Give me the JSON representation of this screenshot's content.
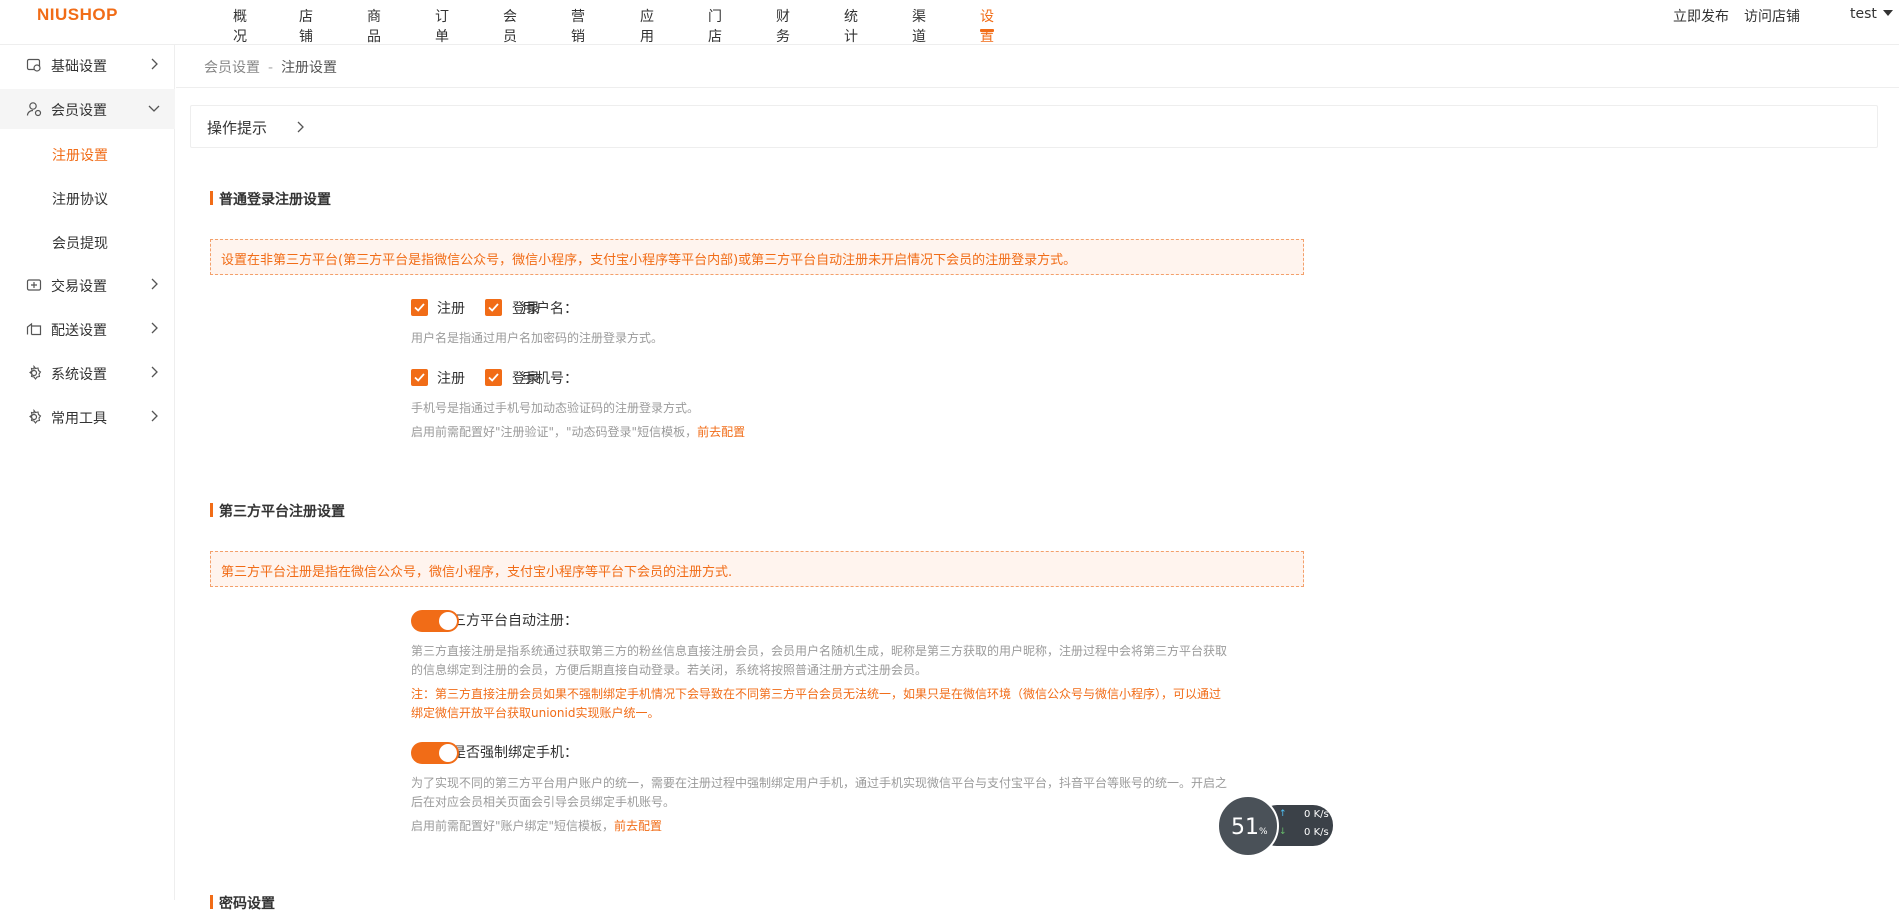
{
  "header": {
    "logo": "NIUSHOP",
    "nav": [
      "概况",
      "店铺",
      "商品",
      "订单",
      "会员",
      "营销",
      "应用",
      "门店",
      "财务",
      "统计",
      "渠道",
      "设置"
    ],
    "active_nav": "设置",
    "publish": "立即发布",
    "visit_store": "访问店铺",
    "user": "test"
  },
  "sidebar": {
    "items": [
      {
        "label": "基础设置",
        "icon": "basic-settings-icon"
      },
      {
        "label": "会员设置",
        "icon": "member-icon"
      },
      {
        "label": "交易设置",
        "icon": "trade-icon"
      },
      {
        "label": "配送设置",
        "icon": "delivery-icon"
      },
      {
        "label": "系统设置",
        "icon": "gear-icon"
      },
      {
        "label": "常用工具",
        "icon": "tool-icon"
      }
    ],
    "sub_items": [
      "注册设置",
      "注册协议",
      "会员提现"
    ],
    "active_sub": "注册设置"
  },
  "breadcrumb": {
    "parent": "会员设置",
    "separator": "-",
    "current": "注册设置"
  },
  "tip": {
    "label": "操作提示"
  },
  "section1": {
    "title": "普通登录注册设置",
    "alert": "设置在非第三方平台(第三方平台是指微信公众号，微信小程序，支付宝小程序等平台内部)或第三方平台自动注册未开启情况下会员的注册登录方式。",
    "username": {
      "label": "用户名：",
      "register": "注册",
      "login": "登录",
      "help": "用户名是指通过用户名加密码的注册登录方式。"
    },
    "mobile": {
      "label": "手机号：",
      "register": "注册",
      "login": "登录",
      "help": "手机号是指通过手机号加动态验证码的注册登录方式。",
      "help2": "启用前需配置好\"注册验证\"，\"动态码登录\"短信模板，",
      "link": "前去配置"
    }
  },
  "section2": {
    "title": "第三方平台注册设置",
    "alert": "第三方平台注册是指在微信公众号，微信小程序，支付宝小程序等平台下会员的注册方式.",
    "auto_register": {
      "label": "允许三方平台自动注册：",
      "enabled": true,
      "help1": "第三方直接注册是指系统通过获取第三方的粉丝信息直接注册会员，会员用户名随机生成，昵称是第三方获取的用户昵称，注册过程中会将第三方平台获取",
      "help2": "的信息绑定到注册的会员，方便后期直接自动登录。若关闭，系统将按照普通注册方式注册会员。",
      "warn1": "注：第三方直接注册会员如果不强制绑定手机情况下会导致在不同第三方平台会员无法统一，如果只是在微信环境（微信公众号与微信小程序），可以通过",
      "warn2": "绑定微信开放平台获取unionid实现账户统一。"
    },
    "force_bind": {
      "label": "是否强制绑定手机：",
      "enabled": true,
      "help1": "为了实现不同的第三方平台用户账户的统一，需要在注册过程中强制绑定用户手机，通过手机实现微信平台与支付宝平台，抖音平台等账号的统一。开启之",
      "help2": "后在对应会员相关页面会引导会员绑定手机账号。",
      "help3": "启用前需配置好\"账户绑定\"短信模板，",
      "link": "前去配置"
    }
  },
  "section3": {
    "title": "密码设置"
  },
  "net_widget": {
    "percent": "51",
    "percent_unit": "%",
    "up": "0",
    "down": "0",
    "unit": "K/s"
  },
  "colors": {
    "accent": "#f16c17",
    "alert_bg": "#fff4ee"
  }
}
